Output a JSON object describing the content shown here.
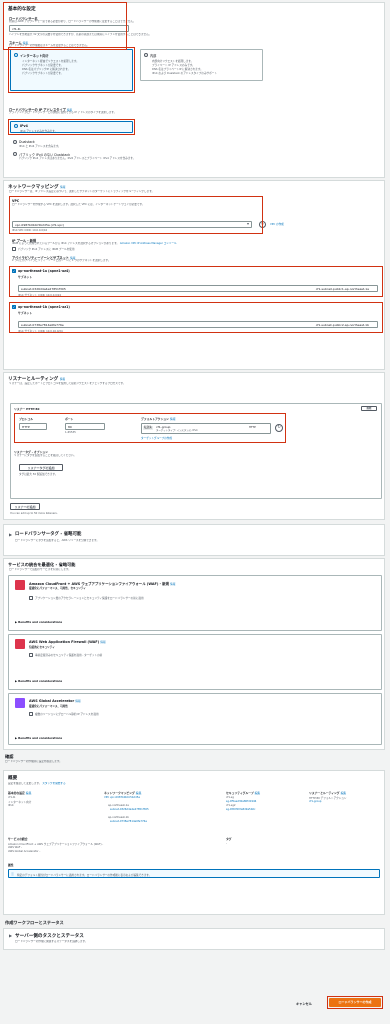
{
  "basic": {
    "title": "基本的な設定",
    "lb_name_label": "ロードバランサー名",
    "lb_name_desc": "名前は AWS アカウントで一意である必要があり、ロードバランサーの作成後に変更することはできません。",
    "lb_name_value": "cf1-lb",
    "lb_name_hint": "ハイフンを含め最大 32 文字の英数字を使用できますが、名前の先頭または末尾にハイフンを使用することはできません。",
    "scheme_label": "スキーム",
    "scheme_info": "情報",
    "scheme_desc": "ロードバランサーの作成後はスキームを変更することはできません。",
    "internet_label": "インターネット向け",
    "internet_bullets": [
      "インターネット経由でリクエストを処理します。",
      "パブリックサブネットが必要です。",
      "DNS 名はパブリックIP に解決されます。",
      "パブリックサブネットが必要です。"
    ],
    "internal_label": "内部",
    "internal_bullets": [
      "内部向けリクエストを処理します。",
      "プライベート IP アドレスのみです。",
      "DNS 名はプライベートIP に解決されます。",
      "IPv4 および Dualstack のアドレスタイプのみサポート"
    ],
    "ip_label": "ロードバランサーの IP アドレスタイプ",
    "ip_info": "情報",
    "ip_desc": "クライアントがロードバランサーとの通信に使用できる IP アドレスのタイプを選択します。",
    "ipv4_label": "IPv4",
    "ipv4_desc": "IPv4 アドレスのみを含みます。",
    "dual_label": "Dualstack",
    "dual_desc": "IPv4 と IPv6 アドレスを含みます。",
    "dual2_label": "パブリック IPv4 のない Dualstack",
    "dual2_desc": "パブリック IPv4 アドレスはありません。IPv6 アドレスとプライベート IPv4 アドレスを含みます。"
  },
  "network": {
    "title": "ネットワークマッピング",
    "info": "情報",
    "desc": "ロードバランサーは、IP アドレス設定に基づいて、選択したサブネットのターゲットにトラフィックをルーティングします。",
    "vpc_label": "VPC",
    "vpc_desc": "ロードバランサーを作成する VPC を選択します。選択した VPC には、インターネットゲートウェイが必要です。",
    "vpc_value": "vpc-0987b0b0c5b2d5a (cf1-vpc)",
    "vpc_cidr": "IPv4 VPC CIDR: 10.0.0.0/16",
    "vpc_create": "VPC の作成",
    "ipam_label": "IP プール - 新規",
    "ipam_desc": "IPAM によって管理されているプールから IPv4 アドレスを選択するオプションがあります。",
    "ipam_link": "Amazon VPC IP Address Manager コンソール",
    "ipam_check": "パブリック IPv4 アドレスに IPAM プールを使用",
    "az_label": "アベイラビリティーゾーンとサブネット",
    "az_info": "情報",
    "az_desc": "2 つ以上のアベイラビリティーゾーンと各ゾーンに 1 つのサブネットを選択します。",
    "zones": [
      {
        "name": "ap-northeast-1a (apne1-az4)",
        "subnet_label": "サブネット",
        "subnet_id": "subnet-0326d4a4e27851f305",
        "subnet_name": "cf1-subnet-public1-ap-northeast-1a",
        "cidr": "IPv4 サブネット CIDR: 10.0.0.0/24"
      },
      {
        "name": "ap-northeast-1b (apne1-az1)",
        "subnet_label": "サブネット",
        "subnet_id": "subnet-0738e7814e0fe776e",
        "subnet_name": "cf1-subnet-public2-ap-northeast-1b",
        "cidr": "IPv4 サブネット CIDR: 10.0.16.0/24"
      }
    ]
  },
  "listener": {
    "title": "リスナーとルーティング",
    "info": "情報",
    "desc": "リスナーは、設定したポートとプロトコルを使用して接続リクエストをチェックするプロセスです。",
    "header": "リスナー HTTP:80",
    "remove": "削除",
    "protocol_label": "プロトコル",
    "protocol_value": "HTTP",
    "port_label": "ポート",
    "port_value": "80",
    "port_hint": "1-65535",
    "action_label": "デフォルトアクション",
    "action_info": "情報",
    "action_prefix": "転送先",
    "action_value": "cf1-group",
    "action_sub": "ターゲットタイプ: インスタンス, IPv4",
    "action_proto": "HTTP",
    "create_tg": "ターゲットグループの作成",
    "tags_label": "リスナータグ - オプション",
    "tags_desc": "リスナーにタグを追加することを検討してください。",
    "add_tag": "リスナータグの追加",
    "tag_hint": "タグは最大 50 個追加できます。",
    "add_listener": "リスナーの追加",
    "listener_hint": "You can add up to 50 more listeners."
  },
  "attrs": {
    "title": "ロードバランサータグ - 省略可能",
    "desc": "ロードバランサーにタグを追加すると、AWS リソースを分類できます。"
  },
  "services": {
    "title": "サービスの統合を最適化 - 省略可能",
    "desc": "ロードバランサーで追加のサービスを有効にします。",
    "items": [
      {
        "title": "Amazon CloudFront + AWS ウェブアプリケーションファイアウォール (WAF) - 新規",
        "info": "情報",
        "sub": "最適化にパフォーマンス、可用性、セキュリティ",
        "check": "アプリケーション層のアクセラレーションとセキュリティ保護をロードバランサーの前に適用",
        "benefits": "Benefits and considerations",
        "color": "#dd344c"
      },
      {
        "title": "AWS Web Application Firewall (WAF)",
        "info": "情報",
        "sub": "包括的にセキュリティ",
        "check": "事前定義済みのセキュリティ保護を適用 - ターゲットの前",
        "benefits": "Benefits and considerations",
        "color": "#dd344c"
      },
      {
        "title": "AWS Global Accelerator",
        "info": "情報",
        "sub": "最適化にパフォーマンス、可用性",
        "check": "複数のリージョンにグローバル静的 IP アドレスを適用",
        "benefits": "Benefits and considerations",
        "color": "#8c4fff"
      }
    ]
  },
  "review": {
    "title": "確認",
    "desc": "ロードバランサーの作成前に設定を確認します。",
    "summary_title": "概要",
    "summary_desc": "設定を確認して変更します。",
    "summary_link": "スタックを開始する",
    "cols": [
      {
        "title": "基本的な設定",
        "edit": "編集",
        "lines": [
          "cf1-lb",
          "インターネット向け",
          "IPv4"
        ]
      },
      {
        "title": "ネットワークマッピング",
        "edit": "編集",
        "lines": [
          "VPC vpc-0987b0b0c5b2d5a",
          "ap-northeast-1a",
          "subnet-0326d4a4e27851f305",
          "ap-northeast-1b",
          "subnet-0738e7814e0fe776e"
        ]
      },
      {
        "title": "セキュリティグループ",
        "edit": "編集",
        "lines": [
          "cf1-sg",
          "sg-0f5ae230a80fd1946",
          "cf1-sg2",
          "sg-0fd0f1f2a8d9a5b0c"
        ]
      },
      {
        "title": "リスナーとルーティング",
        "edit": "編集",
        "lines": [
          "HTTP:80 デフォルトアクション",
          "cf1-group"
        ]
      }
    ],
    "services_title": "サービスの統合",
    "services_lines": [
      "Amazon CloudFront + AWS ウェブアプリケーションファイアウォール (WAF) -",
      "AWS WAF -",
      "AWS Global Accelerator -"
    ],
    "tags_title": "タグ",
    "tags_value": "-",
    "attr_title": "属性",
    "attr_note": "特定のデフォルト属性がロードバランサーに適用されます。ロードバランサーの作成後に表示および編集できます。"
  },
  "workflow": {
    "title": "作成ワークフローとステータス",
    "item_title": "サーバー側のタスクとステータス",
    "item_desc": "ロードバランサーの作成に関連するステータスを追跡します。"
  },
  "footer": {
    "cancel": "キャンセル",
    "create": "ロードバランサーの作成"
  }
}
